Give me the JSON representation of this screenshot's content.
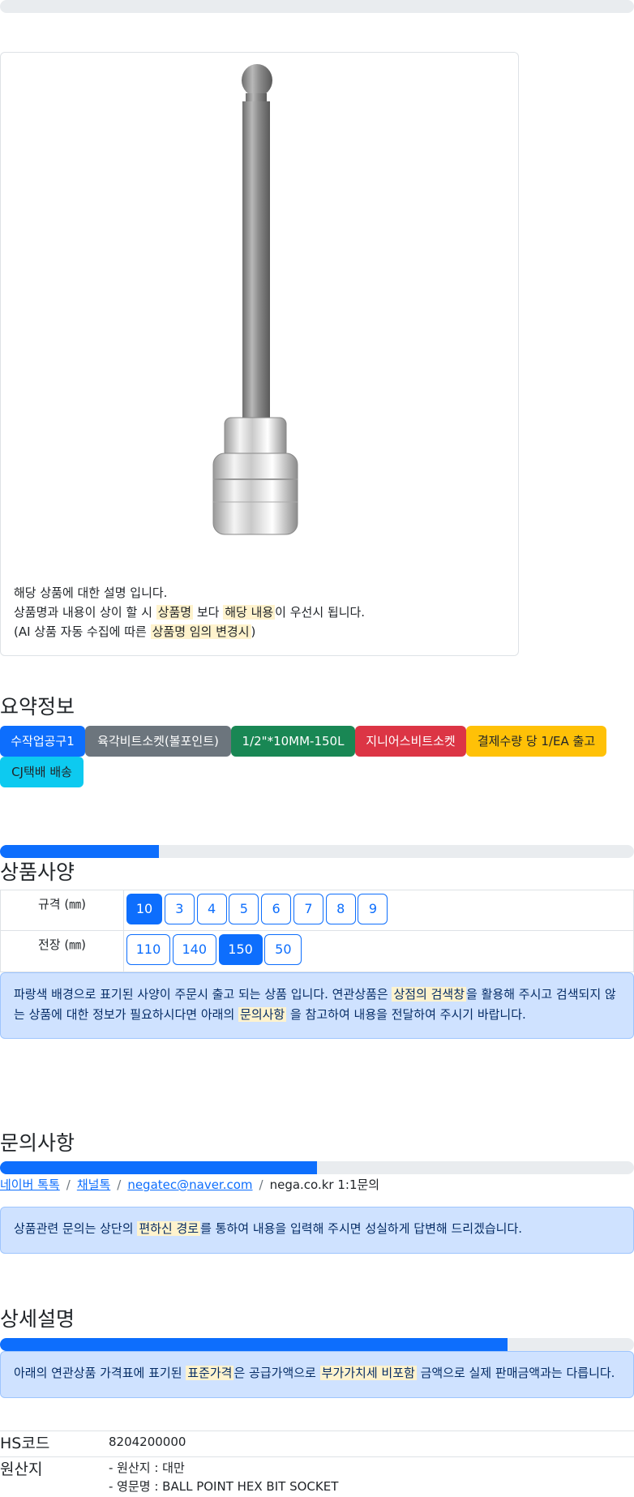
{
  "product_card": {
    "image_name": "hex-bit-socket-ball-point",
    "lines": [
      [
        "해당 상품에 대한 설명 입니다."
      ],
      [
        "상품명과 내용이 상이 할 시 ",
        "상품명",
        " 보다 ",
        "해당 내용",
        "이 우선시 됩니다."
      ],
      [
        "(AI 상품 자동 수집에 따른 ",
        "상품명 임의 변경시",
        ")"
      ]
    ],
    "line1": "해당 상품에 대한 설명 입니다.",
    "line2_a": "상품명과 내용이 상이 할 시 ",
    "line2_hl1": "상품명",
    "line2_b": " 보다 ",
    "line2_hl2": "해당 내용",
    "line2_c": "이 우선시 됩니다.",
    "line3_a": "(AI 상품 자동 수집에 따른 ",
    "line3_hl": "상품명 임의 변경시",
    "line3_b": ")"
  },
  "summary": {
    "title": "요약정보",
    "badges": [
      {
        "label": "수작업공구1",
        "color": "#0d6efd"
      },
      {
        "label": "육각비트소켓(볼포인트)",
        "color": "#6c757d"
      },
      {
        "label": "1/2\"*10MM-150L",
        "color": "#198754"
      },
      {
        "label": "지니어스비트소켓",
        "color": "#dc3545"
      },
      {
        "label": "결제수량 당 1/EA 출고",
        "color": "#ffc107"
      },
      {
        "label": "CJ택배 배송",
        "color": "#0dcaf0"
      }
    ]
  },
  "spec": {
    "title": "상품사양",
    "progress": 0.25,
    "rows": [
      {
        "label": "규격 (㎜)",
        "options": [
          "10",
          "3",
          "4",
          "5",
          "6",
          "7",
          "8",
          "9"
        ],
        "selected": "10"
      },
      {
        "label": "전장 (㎜)",
        "options": [
          "110",
          "140",
          "150",
          "50"
        ],
        "selected": "150"
      }
    ],
    "notice_a": "파랑색 배경으로 표기된 사양이 주문시 출고 되는 상품 입니다. 연관상품은 ",
    "notice_hl1": "상점의 검색창",
    "notice_b": "을 활용해 주시고 검색되지 않는 상품에 대한 정보가 필요하시다면 아래의 ",
    "notice_hl2": "문의사항",
    "notice_c": " 을 참고하여 내용을 전달하여 주시기 바랍니다."
  },
  "inquiry": {
    "title": "문의사항",
    "progress": 0.5,
    "links": [
      "네이버 톡톡",
      "채널톡",
      "negatec@naver.com"
    ],
    "last": "nega.co.kr 1:1문의",
    "notice_a": "상품관련 문의는 상단의 ",
    "notice_hl": "편하신 경로",
    "notice_b": "를 통하여 내용을 입력해 주시면 성실하게 답변해 드리겠습니다."
  },
  "detail": {
    "title": "상세설명",
    "progress": 0.8,
    "notice_a": "아래의 연관상품 가격표에 표기된 ",
    "notice_hl1": "표준가격",
    "notice_b": "은 공급가액으로 ",
    "notice_hl2": "부가가치세 비포함",
    "notice_c": " 금액으로 실제 판매금액과는 다릅니다.",
    "hs_label": "HS코드",
    "hs_value": "8204200000",
    "origin_label": "원산지",
    "origin_line1": "- 원산지 : 대만",
    "origin_line2": "- 영문명 : BALL POINT HEX BIT SOCKET"
  }
}
